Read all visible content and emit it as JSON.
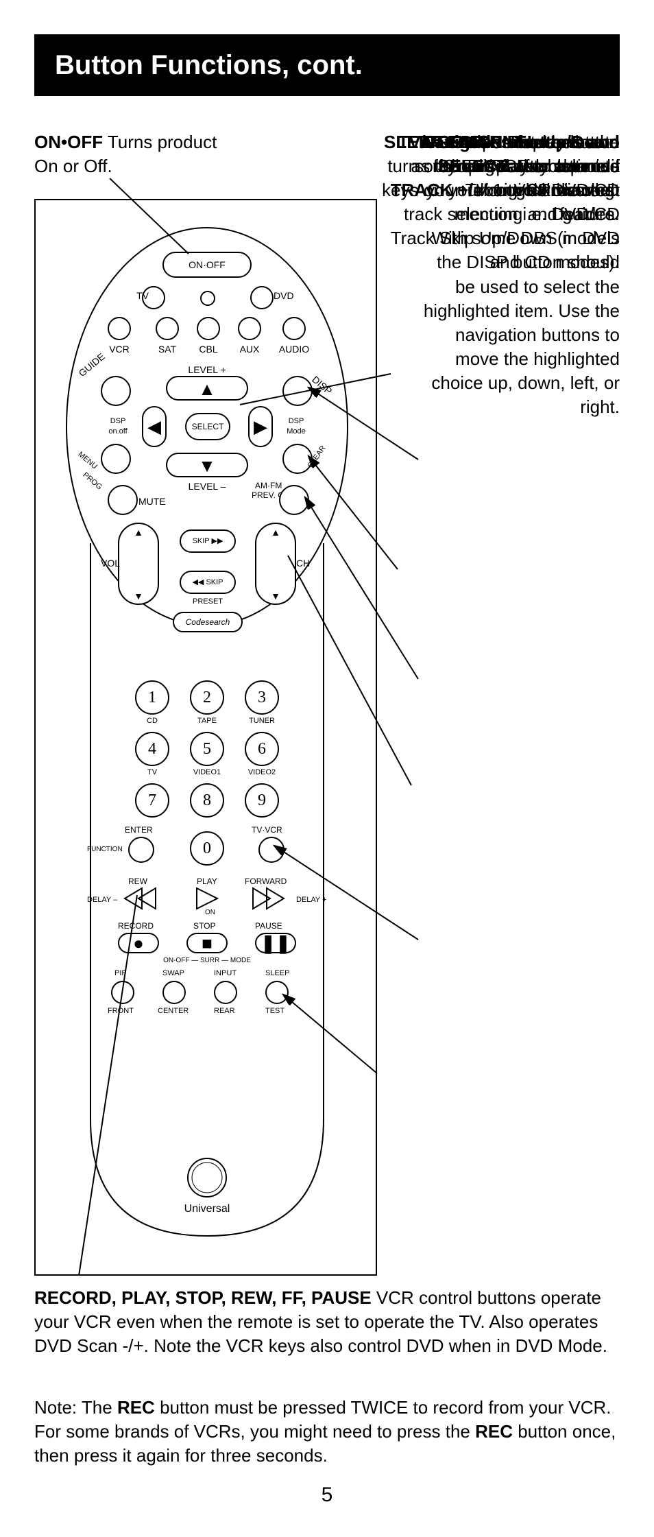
{
  "title": "Button Functions, cont.",
  "on_off": {
    "bold": "ON•OFF",
    "text": " Turns product On or Off."
  },
  "nav": {
    "bold": "Navigation buttons and SELECT",
    "text": " used to move through on-screen menuing and guides. With some DBS models the DISP button should be used to select the highlighted item. Use the navigation buttons to move the highlighted choice up, down, left, or right."
  },
  "disp": {
    "bold": "DISP",
    "text": " Display button shows date and time if your TV or VCR has that feature."
  },
  "clear": {
    "bold": "CLEAR",
    "text": " Removes the on screen display to return to normal viewing."
  },
  "prevch": {
    "bold": "PREV.CH",
    "text": "  Returns to the previously selected channel."
  },
  "chupdown": {
    "bold": "CHANNEL Up/Down",
    "text1": "Changes the channels",
    "bold2": "TRACK +/-",
    "text2": "  controls DVD/CD track selection i.e. DVD/CD Track Skip Up/Down (in DVD and CD modes)."
  },
  "tvvcr": {
    "bold": "TV/VCR",
    "text": " Operates the same as the TV/VCR or antenna keys on your original remotes."
  },
  "sleep": {
    "bold": "SLEEP",
    "text": " enables the remote to turn off your TV after a period of 1 to 99 minutes."
  },
  "record_block": {
    "bold": "RECORD, PLAY, STOP, REW, FF, PAUSE",
    "text": " VCR control buttons operate your VCR even when the remote is set to operate the TV. Also operates DVD Scan -/+. Note the VCR keys also control DVD when in DVD Mode."
  },
  "note_block": {
    "pre": "Note: The ",
    "b1": "REC",
    "mid": " button must be pressed TWICE to record from your VCR. For some brands of VCRs, you might need to press the ",
    "b2": "REC",
    "post": " button once, then press it again for three seconds."
  },
  "page_number": "5",
  "remote": {
    "brand": "Universal",
    "top_btn": "ON·OFF",
    "row1": [
      "TV",
      "",
      "DVD"
    ],
    "row2": [
      "VCR",
      "SAT",
      "CBL",
      "AUX",
      "AUDIO"
    ],
    "nav_labels": {
      "guide": "GUIDE",
      "disp": "DISP",
      "menu": "MENU",
      "prog": "PROG",
      "clear": "CLEAR",
      "level_plus": "LEVEL +",
      "level_minus": "LEVEL –",
      "select": "SELECT",
      "dsp_onoff": "DSP on.off",
      "dsp_mode": "DSP Mode"
    },
    "mid": {
      "mute": "MUTE",
      "amfm": "AM·FM",
      "prevch": "PREV. CH",
      "vol": "VOL",
      "ch": "CH",
      "skip_fwd": "SKIP ▶▶",
      "skip_back": "◀◀ SKIP",
      "preset": "PRESET",
      "codesearch": "Codesearch"
    },
    "digits": [
      "1",
      "2",
      "3",
      "4",
      "5",
      "6",
      "7",
      "8",
      "9",
      "0"
    ],
    "digit_labels": [
      "CD",
      "TAPE",
      "TUNER",
      "TV",
      "VIDEO1",
      "VIDEO2"
    ],
    "bottom_labels": {
      "enter": "ENTER",
      "tvvcr": "TV·VCR",
      "function": "FUNCTION",
      "rew": "REW",
      "play": "PLAY",
      "on": "ON",
      "forward": "FORWARD",
      "delay_m": "DELAY –",
      "delay_p": "DELAY +",
      "record": "RECORD",
      "stop": "STOP",
      "pause": "PAUSE",
      "onoff_surr": "ON-OFF — SURR — MODE",
      "pip": "PIP",
      "swap": "SWAP",
      "input": "INPUT",
      "sleep": "SLEEP",
      "front": "FRONT",
      "center": "CENTER",
      "rear": "REAR",
      "test": "TEST"
    }
  }
}
